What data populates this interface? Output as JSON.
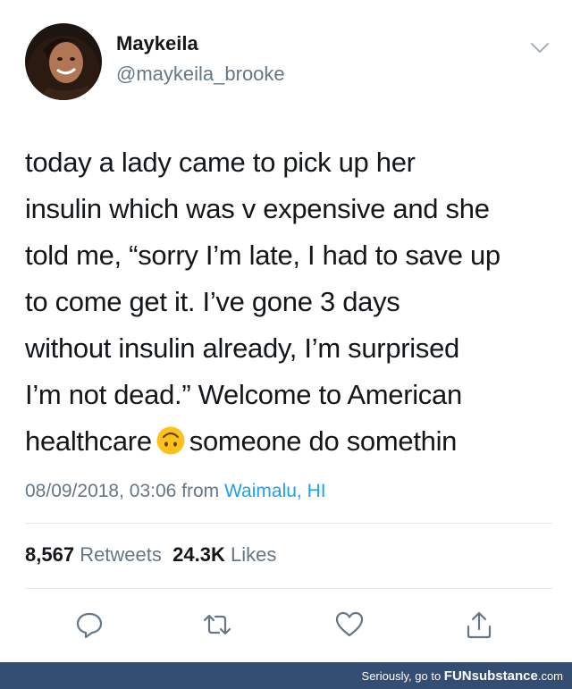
{
  "tweet": {
    "user": {
      "name": "Maykeila",
      "handle": "@maykeila_brooke"
    },
    "body_lines": [
      "today a lady came to pick up her",
      "insulin which was v expensive and she",
      "told me, “sorry I’m late, I had to save up",
      "to come get it. I’ve gone 3 days",
      "without insulin already, I’m surprised",
      "I’m not dead.” Welcome to American"
    ],
    "last_line": {
      "before": "healthcare",
      "emoji_icon": "upside-down-face-emoji",
      "after": "someone do somethin"
    },
    "timestamp": "08/09/2018, 03:06",
    "from_label": "from",
    "location": "Waimalu, HI",
    "stats": {
      "retweets_count": "8,567",
      "retweets_label": "Retweets",
      "likes_count": "24.3K",
      "likes_label": "Likes"
    },
    "actions": [
      "reply-icon",
      "retweet-icon",
      "like-icon",
      "share-icon"
    ]
  },
  "footer": {
    "prefix": "Seriously, go to",
    "brand": "FUNsubstance",
    "suffix": ".com"
  },
  "colors": {
    "text": "#14171a",
    "secondary": "#657786",
    "link": "#1da1f2",
    "divider": "#e1e8ed",
    "footer_bg": "#334d73"
  }
}
